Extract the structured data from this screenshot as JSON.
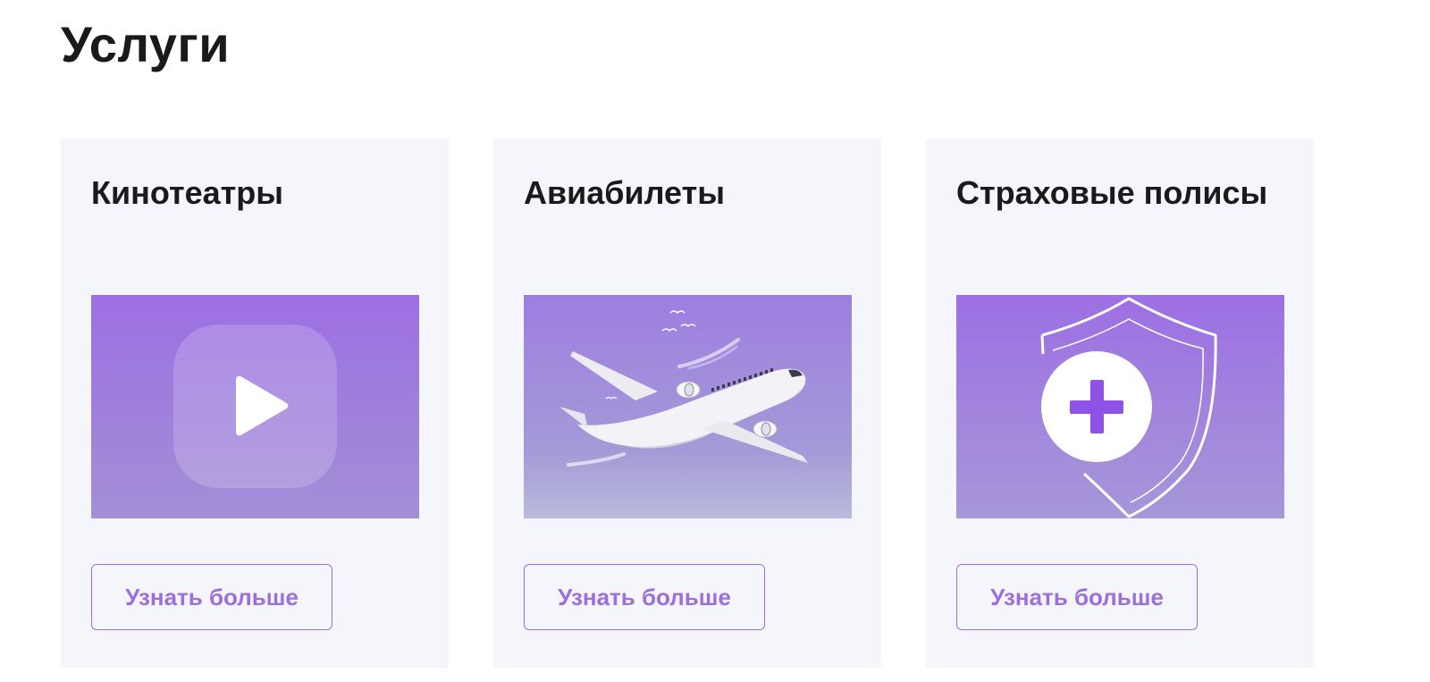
{
  "section": {
    "title": "Услуги"
  },
  "cards": [
    {
      "title": "Кинотеатры",
      "illustration": "play-icon",
      "button_label": "Узнать больше"
    },
    {
      "title": "Авиабилеты",
      "illustration": "airplane-icon",
      "button_label": "Узнать больше"
    },
    {
      "title": "Страховые полисы",
      "illustration": "shield-plus-icon",
      "button_label": "Узнать больше"
    }
  ],
  "colors": {
    "accent": "#9b6fe0",
    "card_background": "#f5f6fb",
    "gradient_top": "#9d6fe3",
    "gradient_bottom": "#b8b9dc",
    "title_text": "#1a1a1a"
  }
}
